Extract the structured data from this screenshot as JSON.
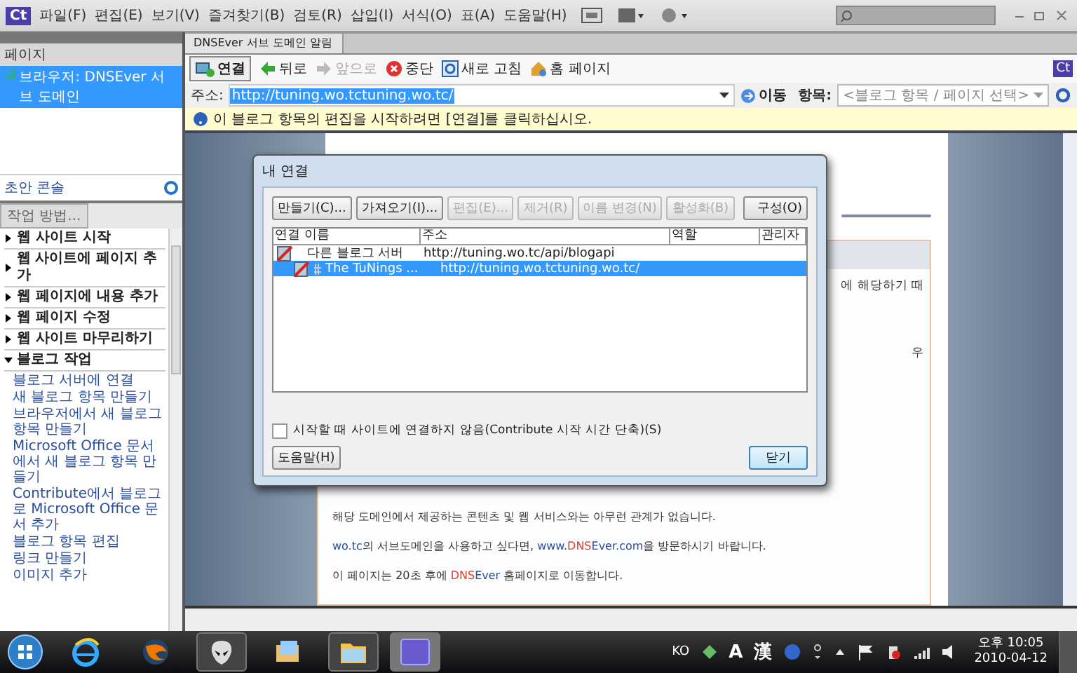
{
  "app": {
    "logo": "Ct",
    "menu": [
      "파일(F)",
      "편집(E)",
      "보기(V)",
      "즐겨찾기(B)",
      "검토(R)",
      "삽입(I)",
      "서식(O)",
      "표(A)",
      "도움말(H)"
    ]
  },
  "pages_panel": {
    "title": "페이지",
    "items": [
      {
        "label": "브라우저: DNSEver 서브 도메인",
        "selected": true
      }
    ],
    "footer": "초안 콘솔"
  },
  "how_to_panel": {
    "tab": "작업 방법...",
    "sections": [
      {
        "label": "웹 사이트 시작",
        "expanded": false
      },
      {
        "label": "웹 사이트에 페이지 추가",
        "expanded": false
      },
      {
        "label": "웹 페이지에 내용 추가",
        "expanded": false
      },
      {
        "label": "웹 페이지 수정",
        "expanded": false
      },
      {
        "label": "웹 사이트 마무리하기",
        "expanded": false
      },
      {
        "label": "블로그 작업",
        "expanded": true,
        "children": [
          "블로그 서버에 연결",
          "새 블로그 항목 만들기",
          "브라우저에서 새 블로그 항목 만들기",
          "Microsoft Office 문서에서 새 블로그 항목 만들기",
          "Contribute에서 블로그로 Microsoft Office 문서 추가",
          "블로그 항목 편집",
          "링크 만들기",
          "이미지 추가"
        ]
      }
    ]
  },
  "document_tab": {
    "title": "DNSEver 서브 도메인 알림",
    "badge": "Ct"
  },
  "toolbar": {
    "connect": "연결",
    "buttons": [
      {
        "kind": "back",
        "label": "뒤로",
        "disabled": false
      },
      {
        "kind": "forward",
        "label": "앞으로",
        "disabled": true
      },
      {
        "kind": "stop",
        "label": "중단",
        "disabled": false
      },
      {
        "kind": "refresh",
        "label": "새로 고침",
        "disabled": false
      },
      {
        "kind": "home",
        "label": "홈 페이지",
        "disabled": false
      }
    ]
  },
  "address": {
    "label": "주소:",
    "value": "http://tuning.wo.tctuning.wo.tc/",
    "go": "이동",
    "item_label": "항목:",
    "item_select": "<블로그 항목 / 페이지 선택>"
  },
  "info_bar": "이 블로그 항목의 편집을 시작하려면 [연결]를 클릭하십시오.",
  "page": {
    "fragments": [
      "에 해당하기 때",
      "우"
    ],
    "lines": [
      [
        {
          "kind": "text",
          "text": "해당 도메인에서 제공하는 콘텐츠 및 웹 서비스와는 아무런 관계가 없습니다."
        }
      ],
      [
        {
          "kind": "link",
          "text": "wo.tc"
        },
        {
          "kind": "text",
          "text": "의 서브도메인을 사용하고 싶다면, "
        },
        {
          "kind": "link",
          "text": "www."
        },
        {
          "kind": "brand",
          "text": "DNS"
        },
        {
          "kind": "link",
          "text": "Ever.com"
        },
        {
          "kind": "text",
          "text": "을 방문하시기 바랍니다."
        }
      ],
      [
        {
          "kind": "text",
          "text": "이 페이지는 20초 후에 "
        },
        {
          "kind": "brand",
          "text": "DNS"
        },
        {
          "kind": "link",
          "text": "Ever"
        },
        {
          "kind": "text",
          "text": " 홈페이지로 이동합니다."
        }
      ]
    ]
  },
  "dialog": {
    "title": "내 연결",
    "buttons": [
      {
        "label": "만들기(C)...",
        "disabled": false
      },
      {
        "label": "가져오기(I)...",
        "disabled": false
      },
      {
        "label": "편집(E)...",
        "disabled": true
      },
      {
        "label": "제거(R)",
        "disabled": true
      },
      {
        "label": "이름 변경(N)",
        "disabled": true
      },
      {
        "label": "활성화(B)",
        "disabled": true
      }
    ],
    "configure": "구성(O)",
    "columns": [
      "연결 이름",
      "주소",
      "역할",
      "관리자"
    ],
    "rows": [
      {
        "name": "다른 블로그 서버",
        "address": "http://tuning.wo.tc/api/blogapi",
        "selected": false,
        "children": [
          {
            "name": "The TuNings ...",
            "address": "http://tuning.wo.tctuning.wo.tc/",
            "selected": true
          }
        ]
      }
    ],
    "checkbox": {
      "label": "시작할 때 사이트에 연결하지 않음(Contribute 시작 시간 단축)(S)",
      "checked": false
    },
    "help": "도움말(H)",
    "close": "닫기"
  },
  "taskbar": {
    "lang": "KO",
    "ime_a": "A",
    "ime_han": "漢",
    "time": "오후 10:05",
    "date": "2010-04-12"
  }
}
